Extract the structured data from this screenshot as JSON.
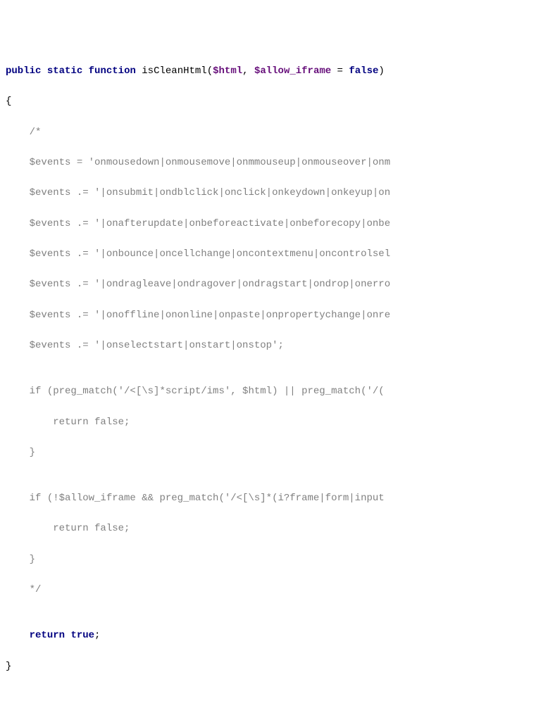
{
  "tokens": {
    "kw_public": "public",
    "kw_static": "static",
    "kw_function": "function",
    "fn_name": "isCleanHtml",
    "var_html": "$html",
    "var_allow": "$allow_iframe",
    "kw_false": "false",
    "kw_return": "return",
    "kw_true": "true",
    "var_events": "$events",
    "op_assign": "=",
    "op_concat": ".=",
    "fn_preg": "preg_match",
    "kw_if": "if"
  },
  "comment": {
    "open": "/*",
    "l1": "$events = 'onmousedown|onmousemove|onmmouseup|onmouseover|onm",
    "l2": "$events .= '|onsubmit|ondblclick|onclick|onkeydown|onkeyup|on",
    "l3": "$events .= '|onafterupdate|onbeforeactivate|onbeforecopy|onbe",
    "l4": "$events .= '|onbounce|oncellchange|oncontextmenu|oncontrolsel",
    "l5": "$events .= '|ondragleave|ondragover|ondragstart|ondrop|onerro",
    "l6": "$events .= '|onoffline|ononline|onpaste|onpropertychange|onre",
    "l7": "$events .= '|onselectstart|onstart|onstop';",
    "blank": "",
    "if1": "if (preg_match('/<[\\s]*script/ims', $html) || preg_match('/(",
    "ret_f1": "    return false;",
    "brace1": "}",
    "blank2": "",
    "if2": "if (!$allow_iframe && preg_match('/<[\\s]*(i?frame|form|input",
    "ret_f2": "    return false;",
    "brace2": "}",
    "close": "*/"
  },
  "strings": {
    "s1": "'onmousedown|onmousemove|onmmouseup|onmouseover|onm",
    "s2": "'|onsubmit|ondblclick|onclick|onkeydown|onkeyup|on",
    "s3": "'|onafterupdate|onbeforeactivate|onbeforecopy|onbe",
    "s4": "'|onbounce|oncellchange|oncontextmenu|oncontrolsel",
    "s5": "'|ondragleave|ondragover|ondragstart|ondrop|onerro",
    "s6": "'|onoffline|ononline|onpaste|onpropertychange|onre",
    "s7": "'|onselectstart|onstart|onstop'",
    "rx1": "'/<[\\s]*script/ims'",
    "rx2": "'/(",
    "rx3": "'/<[\\s]*(i?frame|form|input"
  },
  "punct": {
    "lparen": "(",
    "rparen": ")",
    "comma": ", ",
    "eq": " = ",
    "semi": ";",
    "lbrace": "{",
    "rbrace": "}",
    "bang": "!",
    "andand": " && ",
    "oror": " || ",
    "space": " "
  }
}
